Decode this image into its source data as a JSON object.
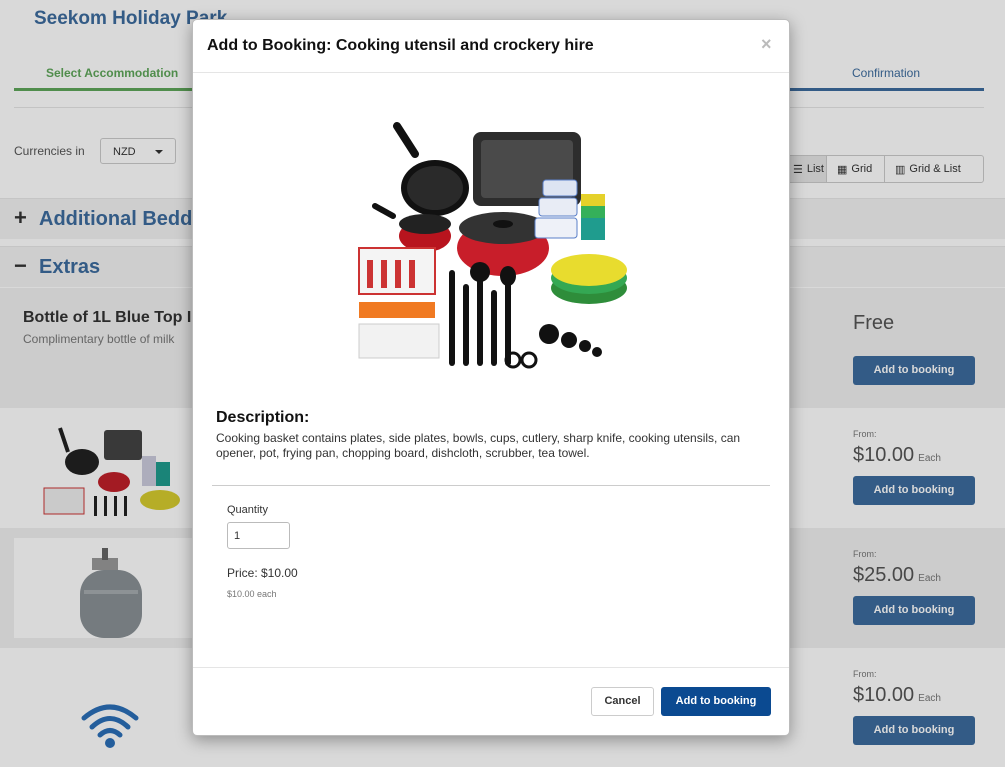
{
  "page": {
    "park_name": "Seekom Holiday Park",
    "steps": {
      "select": "Select Accommodation",
      "confirm": "Confirmation"
    },
    "currency": {
      "label": "Currencies in",
      "selected": "NZD"
    },
    "views": {
      "list": "List",
      "grid": "Grid",
      "grid_list": "Grid & List"
    },
    "sections": {
      "additional": {
        "sign": "+",
        "title": "Additional Bedd"
      },
      "extras": {
        "sign": "−",
        "title": "Extras"
      }
    },
    "items": [
      {
        "title": "Bottle of 1L Blue Top I",
        "subtitle": "Complimentary bottle of milk",
        "price": "Free",
        "button": "Add to booking"
      },
      {
        "from": "From:",
        "price": "$10.00",
        "unit": "Each",
        "button": "Add to booking"
      },
      {
        "from": "From:",
        "price": "$25.00",
        "unit": "Each",
        "button": "Add to booking"
      },
      {
        "from": "From:",
        "price": "$10.00",
        "unit": "Each",
        "button": "Add to booking"
      }
    ],
    "colors": {
      "accent": "#3d6c9e",
      "green": "#5ea65a",
      "primary_button": "#0b4a91"
    }
  },
  "modal": {
    "title": "Add to Booking: Cooking utensil and crockery hire",
    "close": "×",
    "description_heading": "Description:",
    "description": "Cooking basket contains plates, side plates, bowls, cups, cutlery, sharp knife, cooking utensils, can opener, pot, frying pan, chopping board, dishcloth, scrubber, tea towel.",
    "quantity_label": "Quantity",
    "quantity_value": "1",
    "price": "Price: $10.00",
    "each": "$10.00 each",
    "cancel": "Cancel",
    "confirm": "Add to booking"
  }
}
